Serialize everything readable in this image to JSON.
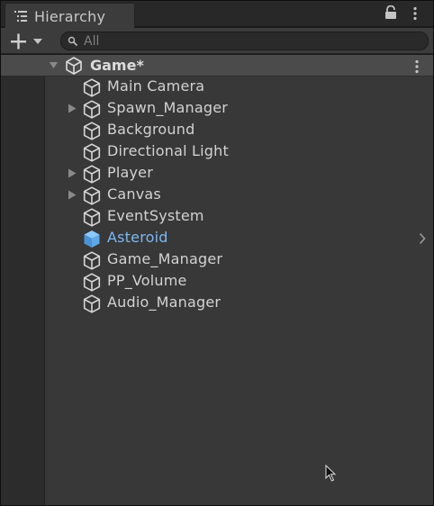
{
  "window": {
    "tab_title": "Hierarchy"
  },
  "toolbar": {
    "search_placeholder": "All"
  },
  "scene": {
    "name": "Game*"
  },
  "hierarchy": {
    "items": [
      {
        "label": "Main Camera",
        "expandable": false,
        "prefab": false
      },
      {
        "label": "Spawn_Manager",
        "expandable": true,
        "prefab": false
      },
      {
        "label": "Background",
        "expandable": false,
        "prefab": false
      },
      {
        "label": "Directional Light",
        "expandable": false,
        "prefab": false
      },
      {
        "label": "Player",
        "expandable": true,
        "prefab": false
      },
      {
        "label": "Canvas",
        "expandable": true,
        "prefab": false
      },
      {
        "label": "EventSystem",
        "expandable": false,
        "prefab": false
      },
      {
        "label": "Asteroid",
        "expandable": false,
        "prefab": true
      },
      {
        "label": "Game_Manager",
        "expandable": false,
        "prefab": false
      },
      {
        "label": "PP_Volume",
        "expandable": false,
        "prefab": false
      },
      {
        "label": "Audio_Manager",
        "expandable": false,
        "prefab": false
      }
    ]
  },
  "icons": {
    "tab": "hierarchy-list-icon",
    "lock": "lock-icon",
    "menu": "kebab-menu-icon",
    "add": "plus-dropdown-icon",
    "search": "search-icon",
    "scene": "unity-logo-icon",
    "gameobject": "cube-icon",
    "prefab": "prefab-cube-icon",
    "expand": "triangle-right-icon"
  },
  "colors": {
    "panel_bg": "#383838",
    "prefab_text": "#7cb7f0",
    "prefab_icon": "#5fa8e8"
  }
}
